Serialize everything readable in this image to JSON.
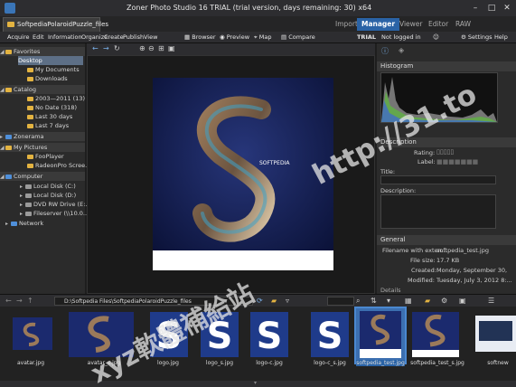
{
  "window": {
    "title": "Zoner Photo Studio 16 TRIAL (trial version, days remaining: 30) x64",
    "minimize": "–",
    "maximize": "□",
    "close": "✕"
  },
  "tabs": {
    "document_tab": "SoftpediaPolaroidPuzzle_files",
    "modes": [
      "Import",
      "Manager",
      "Viewer",
      "Editor",
      "RAW"
    ]
  },
  "menu": {
    "items": [
      "Acquire",
      "Edit",
      "Information",
      "Organize",
      "Create",
      "Publish",
      "View"
    ],
    "view_buttons": [
      "Browser",
      "Preview",
      "Map",
      "Compare"
    ],
    "trial_label": "TRIAL",
    "login_status": "Not logged in",
    "settings": "Settings",
    "help": "Help"
  },
  "left_panel": {
    "favorites_header": "Favorites",
    "favorites": [
      "Desktop",
      "My Documents",
      "Downloads"
    ],
    "catalog_header": "Catalog",
    "catalog": [
      "2003—2011 (13)",
      "No Date (318)",
      "Last 30 days",
      "Last 7 days"
    ],
    "zonerama": "Zonerama",
    "pictures_header": "My Pictures",
    "pictures": [
      "FooPlayer",
      "RadeonPro Scree..."
    ],
    "computer_header": "Computer",
    "drives": [
      "Local Disk (C:)",
      "Local Disk (D:)",
      "DVD RW Drive (E:...",
      "Fileserver (\\\\10.0..."
    ],
    "network": "Network"
  },
  "right_panel": {
    "histogram_header": "Histogram",
    "description_header": "Description",
    "rating_label": "Rating:",
    "label_label": "Label:",
    "title_label": "Title:",
    "desc_label": "Description:",
    "general_header": "General",
    "details_header": "Details",
    "general": [
      {
        "k": "Filename with exten...",
        "v": "softpedia_test.jpg"
      },
      {
        "k": "File size:",
        "v": "17.7 KB"
      },
      {
        "k": "Created:",
        "v": "Monday, September 30,"
      },
      {
        "k": "Modified:",
        "v": "Tuesday, July 3, 2012 8:..."
      }
    ]
  },
  "bottom": {
    "path": "D:\\Softpedia Files\\SoftpediaPolaroidPuzzle_files"
  },
  "filmstrip": [
    {
      "name": "avatar.jpg"
    },
    {
      "name": "avatar_s.jpg"
    },
    {
      "name": "logo.jpg"
    },
    {
      "name": "logo_s.jpg"
    },
    {
      "name": "logo-c.jpg"
    },
    {
      "name": "logo-c_s.jpg"
    },
    {
      "name": "softpedia_test.jpg"
    },
    {
      "name": "softpedia_test_s.jpg"
    },
    {
      "name": "softnew"
    }
  ],
  "photo_caption": "SOFTPEDIA",
  "watermark": {
    "line1": "http://31.to",
    "line2": "xyz軟體補給站"
  },
  "colors": {
    "accent": "#2a63a6",
    "selected": "#4a88d0"
  }
}
